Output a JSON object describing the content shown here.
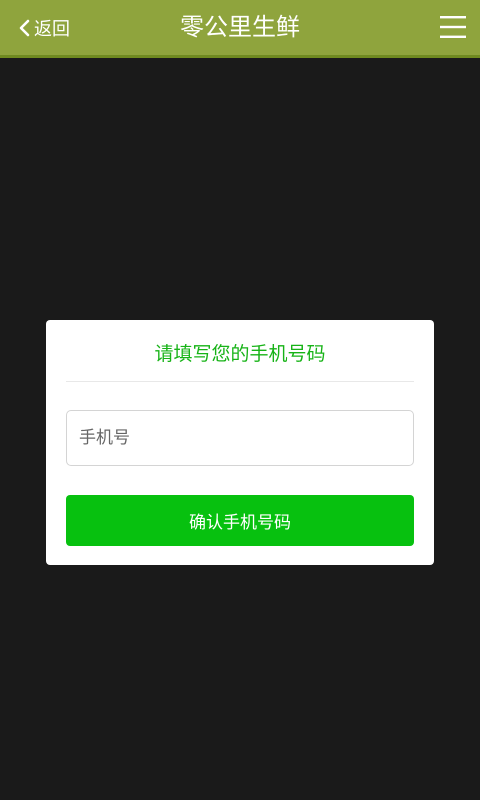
{
  "header": {
    "back_label": "返回",
    "title": "零公里生鲜",
    "back_icon": "chevron-left-icon",
    "menu_icon": "hamburger-menu-icon"
  },
  "dialog": {
    "title": "请填写您的手机号码",
    "phone_placeholder": "手机号",
    "phone_value": "",
    "confirm_label": "确认手机号码"
  },
  "colors": {
    "header_bg": "#8fa43d",
    "overlay_bg": "#1a1a1a",
    "accent_green": "#07c10f",
    "title_green": "#17b317"
  }
}
